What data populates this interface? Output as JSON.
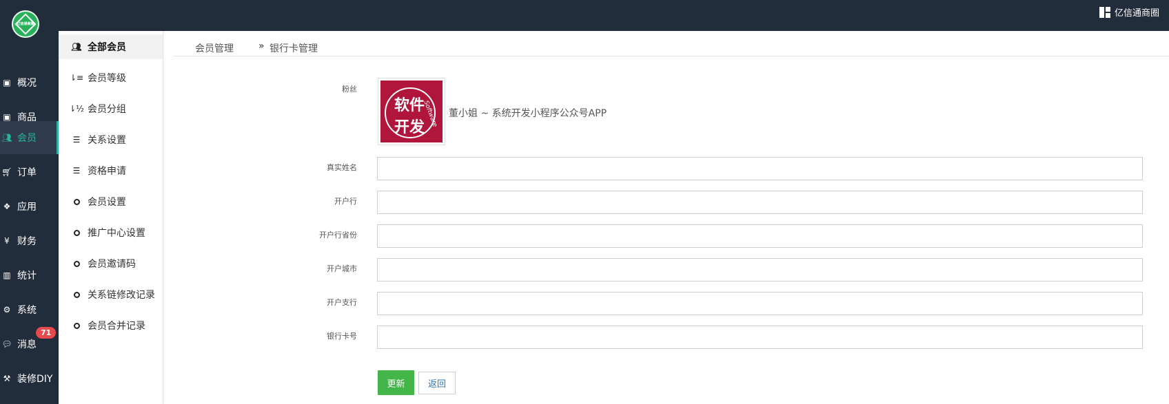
{
  "header": {
    "logo_text": "亿信通商圈",
    "shop_label": "亿信通商圈"
  },
  "sidebar": {
    "items": [
      {
        "label": "概况",
        "icon": "archive-icon"
      },
      {
        "label": "商品",
        "icon": "archive-icon"
      },
      {
        "label": "会员",
        "icon": "users-icon",
        "active": true
      },
      {
        "label": "订单",
        "icon": "cart-icon"
      },
      {
        "label": "应用",
        "icon": "cubes-icon"
      },
      {
        "label": "财务",
        "icon": "yen-icon"
      },
      {
        "label": "统计",
        "icon": "bar-chart-icon"
      },
      {
        "label": "系统",
        "icon": "gears-icon"
      },
      {
        "label": "消息",
        "icon": "comment-icon",
        "badge": "71"
      },
      {
        "label": "装修DIY",
        "icon": "gavel-icon"
      }
    ]
  },
  "subnav": {
    "items": [
      {
        "label": "全部会员",
        "icon": "users-icon",
        "active": true
      },
      {
        "label": "会员等级",
        "icon": "sort-amount-icon"
      },
      {
        "label": "会员分组",
        "icon": "sort-alpha-icon"
      },
      {
        "label": "关系设置",
        "icon": "sliders-icon"
      },
      {
        "label": "资格申请",
        "icon": "sliders-icon"
      },
      {
        "label": "会员设置",
        "icon": "circle-icon"
      },
      {
        "label": "推广中心设置",
        "icon": "circle-icon"
      },
      {
        "label": "会员邀请码",
        "icon": "circle-icon"
      },
      {
        "label": "关系链修改记录",
        "icon": "circle-icon"
      },
      {
        "label": "会员合并记录",
        "icon": "circle-icon"
      }
    ]
  },
  "breadcrumb": {
    "items": [
      "会员管理",
      "银行卡管理"
    ],
    "separator": "»"
  },
  "form": {
    "fans_label": "粉丝",
    "fan_name": "董小姐 ~ 系统开发小程序公众号APP",
    "avatar_text_1": "软件",
    "avatar_text_2": "开发",
    "avatar_text_3": "Software",
    "fields": [
      {
        "label": "真实姓名",
        "value": ""
      },
      {
        "label": "开户行",
        "value": ""
      },
      {
        "label": "开户行省份",
        "value": ""
      },
      {
        "label": "开户城市",
        "value": ""
      },
      {
        "label": "开户支行",
        "value": ""
      },
      {
        "label": "银行卡号",
        "value": ""
      }
    ],
    "submit_label": "更新",
    "back_label": "返回"
  },
  "colors": {
    "topbar": "#222d3b",
    "accent": "#27b5a0",
    "badge": "#e8494d",
    "primary_button": "#44b549"
  }
}
